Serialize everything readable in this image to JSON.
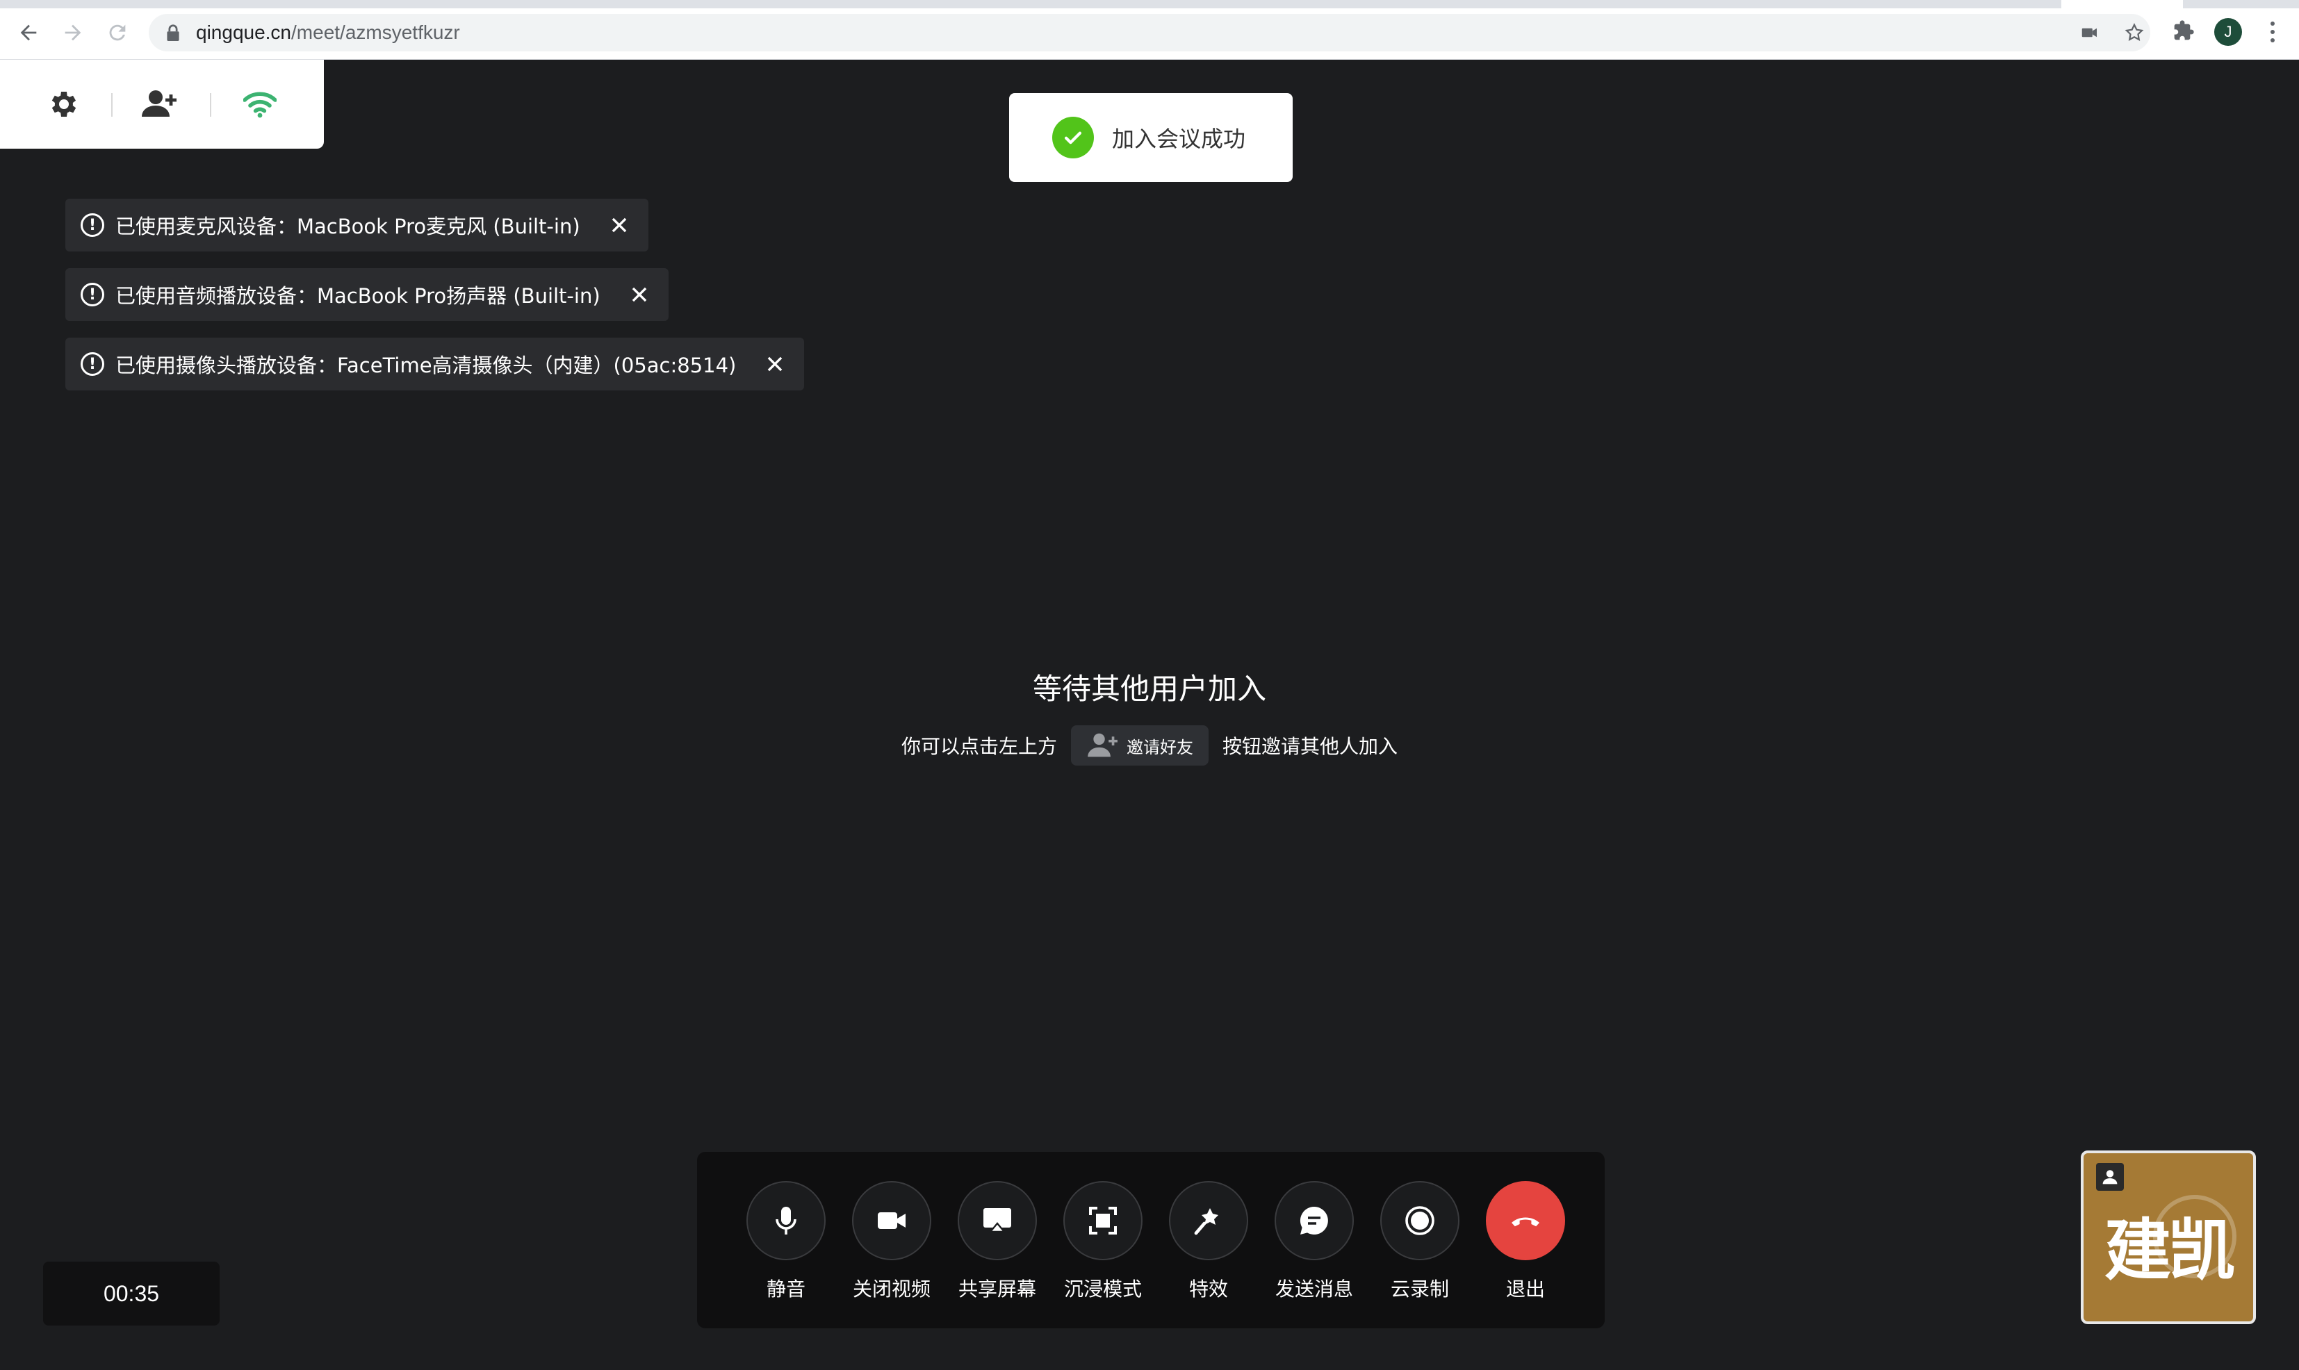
{
  "browser": {
    "url_host": "qingque.cn",
    "url_path": "/meet/azmsyetfkuzr",
    "profile_initial": "J"
  },
  "panel": {
    "icons": [
      "gear-icon",
      "add-user-icon",
      "wifi-signal-icon"
    ]
  },
  "toast": {
    "message": "加入会议成功"
  },
  "notices": [
    {
      "text": "已使用麦克风设备：MacBook Pro麦克风 (Built-in)"
    },
    {
      "text": "已使用音频播放设备：MacBook Pro扬声器 (Built-in)"
    },
    {
      "text": "已使用摄像头播放设备：FaceTime高清摄像头（内建）(05ac:8514)"
    }
  ],
  "waiting": {
    "title": "等待其他用户加入",
    "prefix": "你可以点击左上方",
    "invite_label": "邀请好友",
    "suffix": "按钮邀请其他人加入"
  },
  "toolbar": {
    "items": [
      {
        "label": "静音",
        "icon": "microphone-icon"
      },
      {
        "label": "关闭视频",
        "icon": "video-camera-icon"
      },
      {
        "label": "共享屏幕",
        "icon": "screen-share-icon"
      },
      {
        "label": "沉浸模式",
        "icon": "immersive-mode-icon"
      },
      {
        "label": "特效",
        "icon": "magic-wand-icon"
      },
      {
        "label": "发送消息",
        "icon": "chat-bubble-icon"
      },
      {
        "label": "云录制",
        "icon": "record-icon"
      },
      {
        "label": "退出",
        "icon": "hang-up-icon"
      }
    ]
  },
  "timer": "00:35",
  "self_video": {
    "name": "建凯"
  },
  "colors": {
    "success": "#52c41a",
    "hangup": "#e5443f",
    "wifi": "#3cb371",
    "avatar_bg": "#a57a35"
  }
}
